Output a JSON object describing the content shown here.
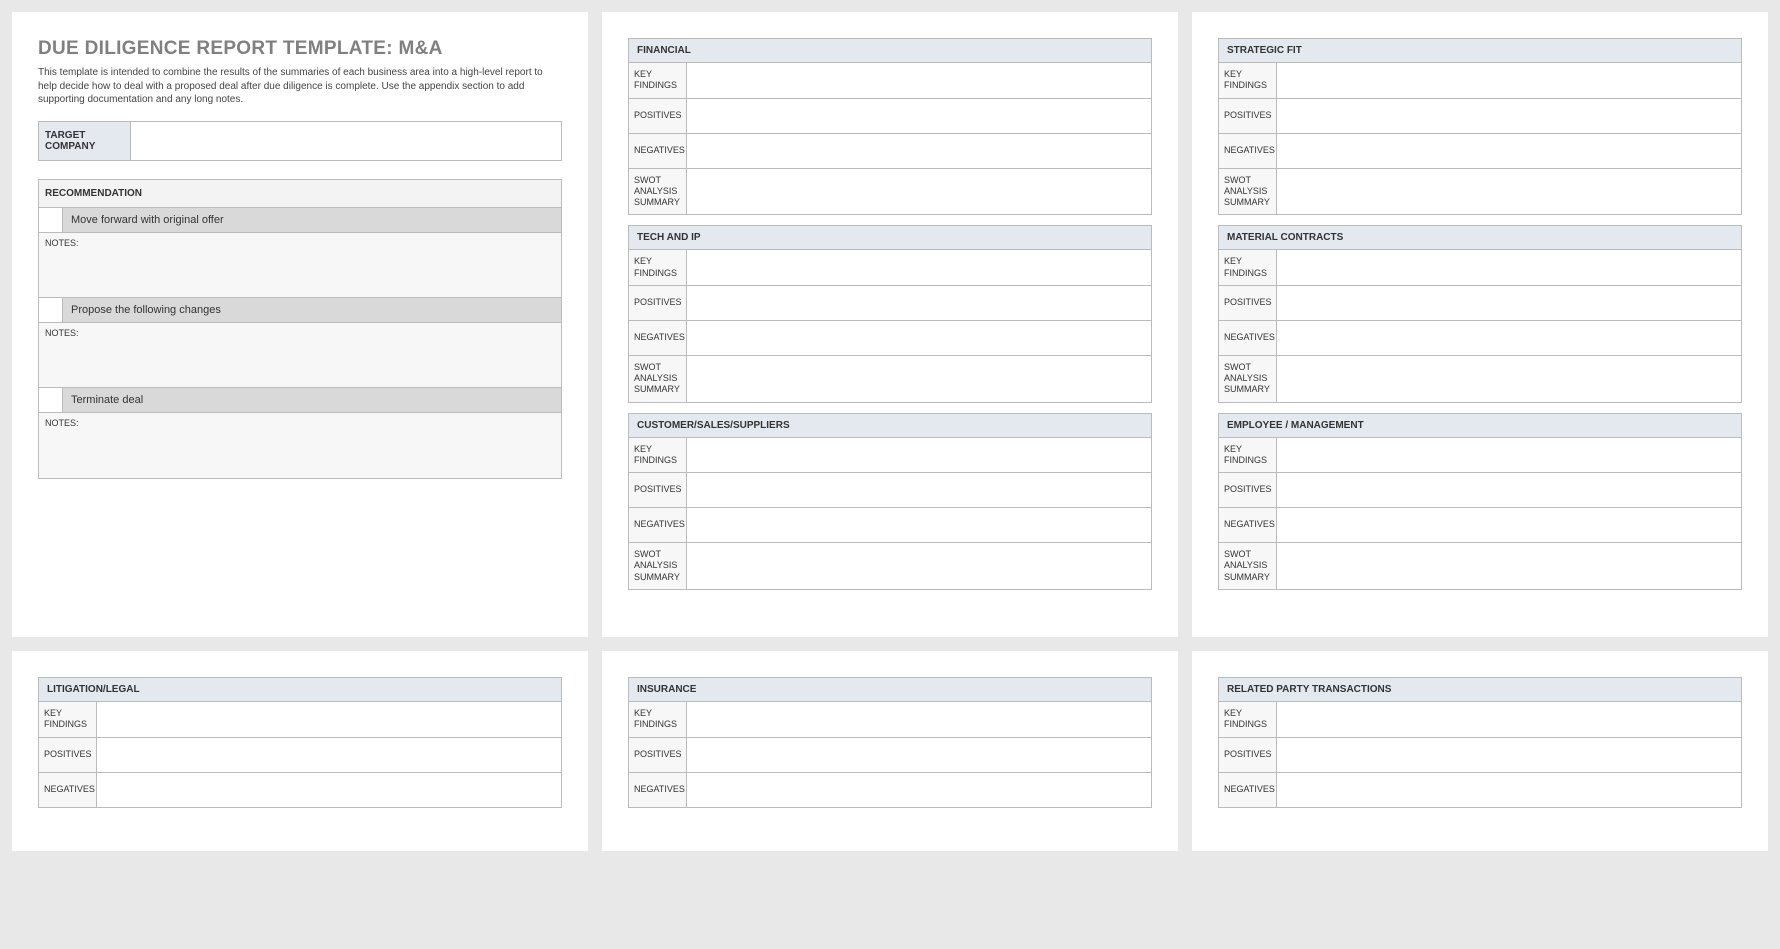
{
  "title": "DUE DILIGENCE REPORT TEMPLATE: M&A",
  "intro": "This template is intended to combine the results of the summaries of each business area into a high-level report to help decide how to deal with a proposed deal after due diligence is complete.  Use the appendix section to add supporting documentation and any long notes.",
  "target_label": "TARGET COMPANY",
  "target_value": "",
  "recommendation_header": "RECOMMENDATION",
  "notes_label": "NOTES:",
  "recommendations": [
    {
      "text": "Move forward with original offer"
    },
    {
      "text": "Propose the following changes"
    },
    {
      "text": "Terminate deal"
    }
  ],
  "row_labels": {
    "key_findings": "KEY FINDINGS",
    "positives": "POSITIVES",
    "negatives": "NEGATIVES",
    "swot": "SWOT ANALYSIS SUMMARY"
  },
  "sections_col2_top": [
    {
      "header": "FINANCIAL"
    },
    {
      "header": "TECH AND IP"
    },
    {
      "header": "CUSTOMER/SALES/SUPPLIERS"
    }
  ],
  "sections_col3_top": [
    {
      "header": "STRATEGIC FIT"
    },
    {
      "header": "MATERIAL CONTRACTS"
    },
    {
      "header": "EMPLOYEE / MANAGEMENT"
    }
  ],
  "sections_bottom": [
    {
      "header": "LITIGATION/LEGAL"
    },
    {
      "header": "INSURANCE"
    },
    {
      "header": "RELATED PARTY TRANSACTIONS"
    }
  ]
}
